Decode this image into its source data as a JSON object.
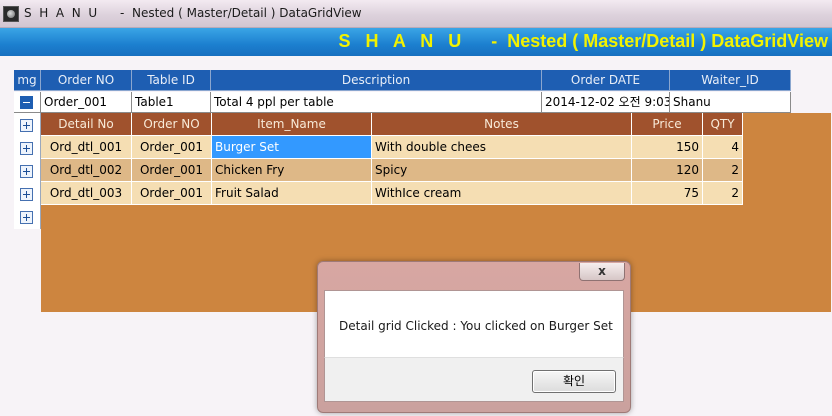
{
  "window": {
    "title": "S  H  A  N  U      -  Nested ( Master/Detail ) DataGridView"
  },
  "banner": {
    "text": "S   H   A   N   U      -  Nested ( Master/Detail ) DataGridView"
  },
  "master": {
    "headers": {
      "img": "mg",
      "order_no": "Order NO",
      "table_id": "Table ID",
      "description": "Description",
      "order_date": "Order DATE",
      "waiter_id": "Waiter_ID"
    },
    "rows": [
      {
        "order_no": "Order_001",
        "table_id": "Table1",
        "description": "Total 4 ppl per table",
        "order_date": "2014-12-02 오전 9:03",
        "waiter_id": "Shanu",
        "expanded": true
      }
    ]
  },
  "detail": {
    "headers": {
      "detail_no": "Detail No",
      "order_no": "Order NO",
      "item_name": "Item_Name",
      "notes": "Notes",
      "price": "Price",
      "qty": "QTY"
    },
    "rows": [
      {
        "detail_no": "Ord_dtl_001",
        "order_no": "Order_001",
        "item_name": "Burger Set",
        "notes": "With double chees",
        "price": "150",
        "qty": "4",
        "selected_cell": "item_name"
      },
      {
        "detail_no": "Ord_dtl_002",
        "order_no": "Order_001",
        "item_name": "Chicken Fry",
        "notes": "Spicy",
        "price": "120",
        "qty": "2"
      },
      {
        "detail_no": "Ord_dtl_003",
        "order_no": "Order_001",
        "item_name": "Fruit Salad",
        "notes": "WithIce cream",
        "price": "75",
        "qty": "2"
      }
    ]
  },
  "dialog": {
    "close_label": "x",
    "message": "Detail grid Clicked : You clicked on Burger Set",
    "ok_label": "확인"
  },
  "colors": {
    "master_header": "#1e5eb2",
    "detail_header": "#a0522d",
    "detail_row_light": "#f5deb3",
    "detail_row_dark": "#deb887",
    "detail_background": "#cd853f",
    "selection": "#3399ff",
    "banner_text": "#f2f200"
  }
}
